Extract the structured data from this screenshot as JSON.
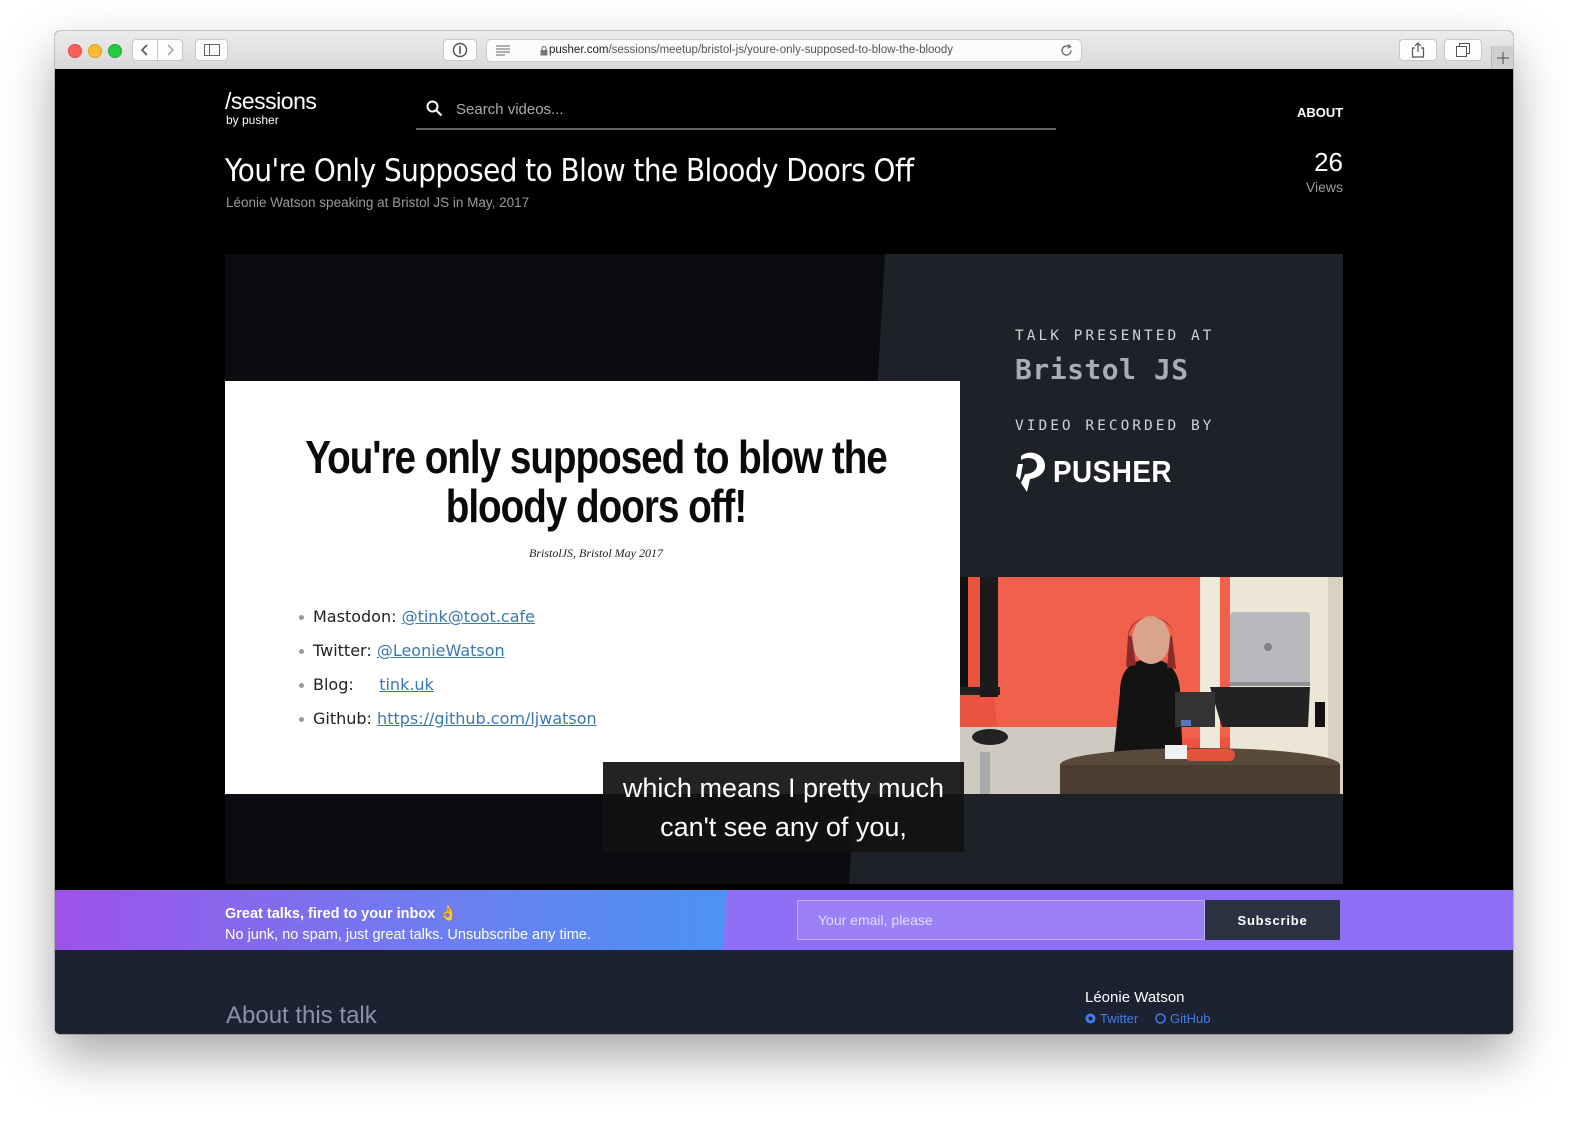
{
  "browser": {
    "url_domain": "pusher.com",
    "url_path": "/sessions/meetup/bristol-js/youre-only-supposed-to-blow-the-bloody"
  },
  "header": {
    "logo_main": "/sessions",
    "logo_sub": "by pusher",
    "search_placeholder": "Search videos...",
    "nav_about": "ABOUT"
  },
  "talk": {
    "title": "You're Only Supposed to Blow the Bloody Doors Off",
    "subtitle": "Léonie Watson speaking at Bristol JS in May, 2017",
    "views_count": "26",
    "views_label": "Views"
  },
  "video": {
    "presented_label": "TALK PRESENTED AT",
    "event_name": "Bristol JS",
    "recorded_label": "VIDEO RECORDED BY",
    "recorder_name": "PUSHER",
    "slide": {
      "title": "You're only supposed to blow the bloody doors off!",
      "subtitle": "BristolJS, Bristol May 2017",
      "links": [
        {
          "label": "Mastodon:",
          "value": "@tink@toot.cafe"
        },
        {
          "label": "Twitter:",
          "value": "@LeonieWatson"
        },
        {
          "label": "Blog:",
          "value": "tink.uk"
        },
        {
          "label": "Github:",
          "value": "https://github.com/ljwatson"
        }
      ]
    },
    "caption_line1": "which means I pretty much",
    "caption_line2": "can't see any of you,"
  },
  "newsletter": {
    "title": "Great talks, fired to your inbox 👌",
    "subtitle": "No junk, no spam, just great talks. Unsubscribe any time.",
    "email_placeholder": "Your email, please",
    "button_label": "Subscribe"
  },
  "about_section": {
    "heading": "About this talk",
    "speaker_name": "Léonie Watson",
    "twitter_label": "Twitter",
    "github_label": "GitHub"
  }
}
